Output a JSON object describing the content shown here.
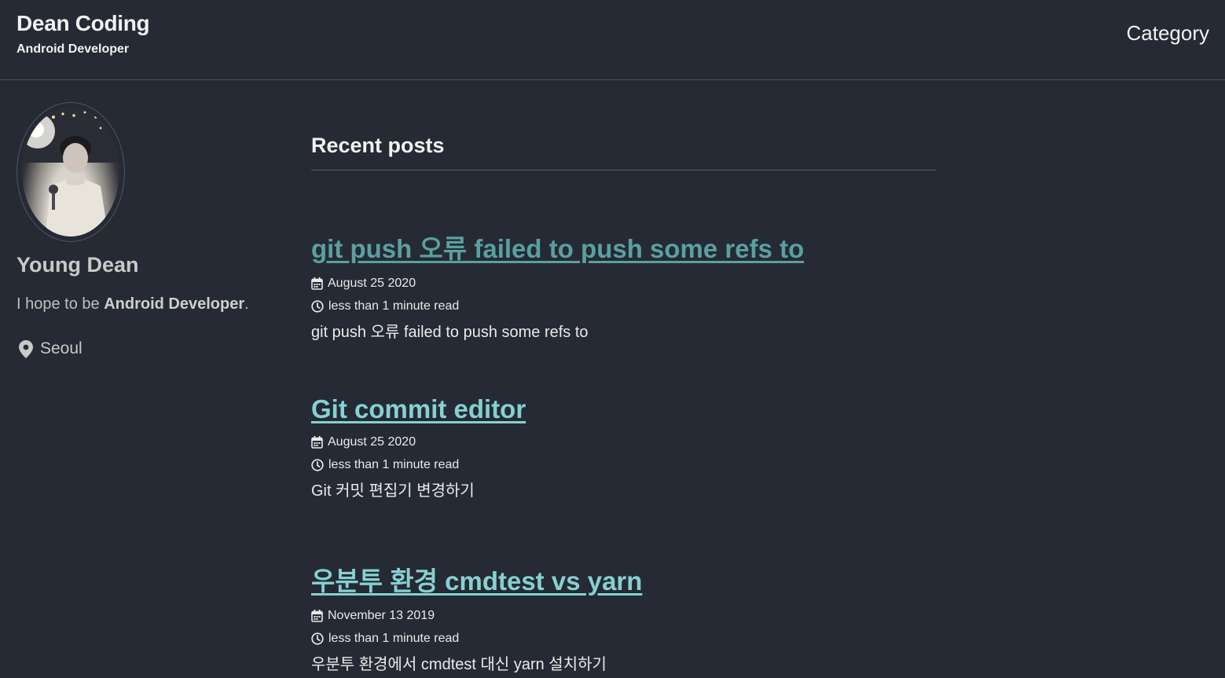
{
  "masthead": {
    "title": "Dean Coding",
    "subtitle": "Android Developer",
    "nav": {
      "category_label": "Category"
    }
  },
  "author": {
    "name": "Young Dean",
    "bio_prefix": "I hope to be ",
    "bio_strong": "Android Developer",
    "bio_suffix": ".",
    "location": "Seoul",
    "location_icon": "map-marker-icon"
  },
  "main": {
    "section_title": "Recent posts",
    "posts": [
      {
        "title": "git push 오류 failed to push some refs to",
        "title_color": "#5aa0a0",
        "date": "August 25 2020",
        "read_time": "less than 1 minute read",
        "excerpt": "git push 오류 failed to push some refs to"
      },
      {
        "title": "Git commit editor",
        "title_color": "#86d0d2",
        "date": "August 25 2020",
        "read_time": "less than 1 minute read",
        "excerpt": "Git 커밋 편집기 변경하기"
      },
      {
        "title": "우분투 환경 cmdtest vs yarn",
        "title_color": "#86d0d2",
        "date": "November 13 2019",
        "read_time": "less than 1 minute read",
        "excerpt": "우분투 환경에서 cmdtest 대신 yarn 설치하기"
      }
    ]
  },
  "colors": {
    "background": "#252a34",
    "text": "#eaeaea",
    "muted_text": "#c9c9c9",
    "link_visited": "#5aa0a0",
    "link": "#86d0d2"
  }
}
